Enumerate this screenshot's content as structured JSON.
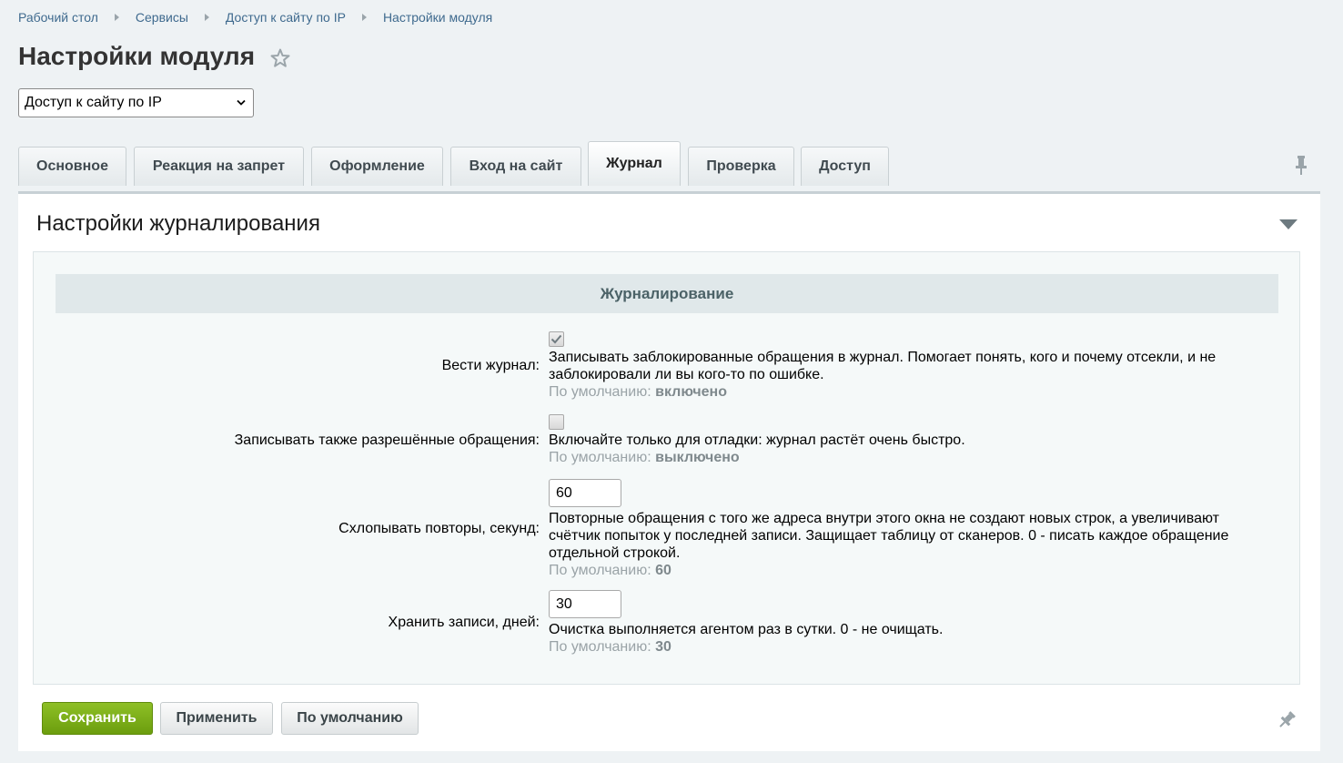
{
  "breadcrumb": [
    "Рабочий стол",
    "Сервисы",
    "Доступ к сайту по IP",
    "Настройки модуля"
  ],
  "page_title": "Настройки модуля",
  "module_select": {
    "value": "Доступ к сайту по IP"
  },
  "tabs": [
    {
      "label": "Основное"
    },
    {
      "label": "Реакция на запрет"
    },
    {
      "label": "Оформление"
    },
    {
      "label": "Вход на сайт"
    },
    {
      "label": "Журнал",
      "active": true
    },
    {
      "label": "Проверка"
    },
    {
      "label": "Доступ"
    }
  ],
  "panel": {
    "title": "Настройки журналирования",
    "section_title": "Журналирование",
    "rows": [
      {
        "label": "Вести журнал:",
        "type": "checkbox",
        "checked": true,
        "desc": "Записывать заблокированные обращения в журнал. Помогает понять, кого и почему отсекли, и не заблокировали ли вы кого-то по ошибке.",
        "default_prefix": "По умолчанию:",
        "default_value": "включено"
      },
      {
        "label": "Записывать также разрешённые обращения:",
        "type": "checkbox",
        "checked": false,
        "desc": "Включайте только для отладки: журнал растёт очень быстро.",
        "default_prefix": "По умолчанию:",
        "default_value": "выключено"
      },
      {
        "label": "Схлопывать повторы, секунд:",
        "type": "number",
        "value": "60",
        "desc": "Повторные обращения с того же адреса внутри этого окна не создают новых строк, а увеличивают счётчик попыток у последней записи. Защищает таблицу от сканеров. 0 - писать каждое обращение отдельной строкой.",
        "default_prefix": "По умолчанию:",
        "default_value": "60"
      },
      {
        "label": "Хранить записи, дней:",
        "type": "number",
        "value": "30",
        "desc": "Очистка выполняется агентом раз в сутки. 0 - не очищать.",
        "default_prefix": "По умолчанию:",
        "default_value": "30"
      }
    ]
  },
  "buttons": {
    "save": "Сохранить",
    "apply": "Применить",
    "default": "По умолчанию"
  },
  "colors": {
    "link": "#3f6a8e",
    "save_button": "#7aad16",
    "background": "#eef2f4"
  },
  "icons": [
    "star-icon",
    "chevron-down-icon",
    "pin-icon",
    "collapse-arrow-icon",
    "checkmark-icon"
  ]
}
